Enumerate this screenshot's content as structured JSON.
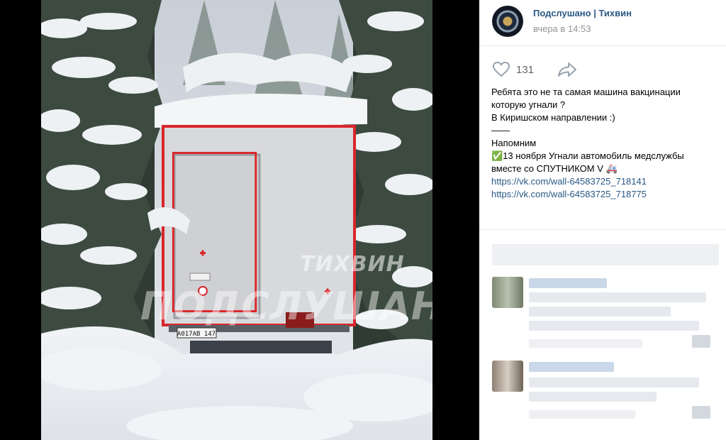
{
  "post": {
    "group_name": "Подслушано | Тихвин",
    "time": "вчера в 14:53",
    "likes": "131",
    "text_lines": [
      "Ребята это не та самая машина вакцинации",
      "которую угнали ?",
      "В Киришском направлении :)",
      "——",
      "Напомним",
      "✅13 ноября Угнали автомобиль медслужбы",
      "вместе со СПУТНИКОМ V 🚑"
    ],
    "links": [
      "https://vk.com/wall-64583725_718141",
      "https://vk.com/wall-64583725_718775"
    ]
  },
  "photo": {
    "watermark_top": "ТИХВИН",
    "watermark_main": "ПОДСЛУШАНО",
    "plate": "А017АВ 147"
  },
  "icons": {
    "like": "heart-icon",
    "share": "share-arrow-icon",
    "avatar": "group-avatar"
  },
  "colors": {
    "link": "#2a5885",
    "muted": "#939393",
    "truck_stripe": "#d9262b"
  }
}
